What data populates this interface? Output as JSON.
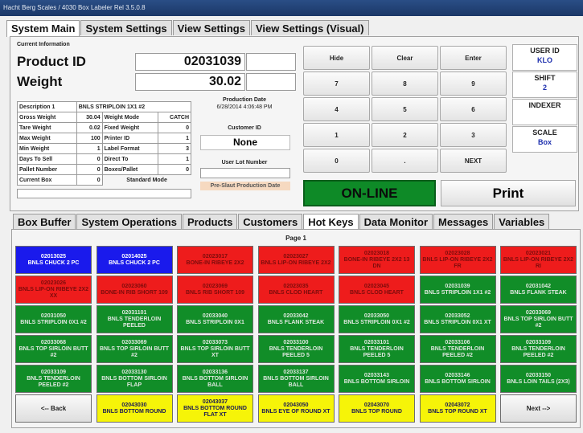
{
  "window": {
    "title": "Hacht Berg Scales / 4030 Box Labeler Rel 3.5.0.8"
  },
  "top_tabs": [
    "System Main",
    "System Settings",
    "View Settings",
    "View Settings (Visual)"
  ],
  "current_info": {
    "section_label": "Current Information",
    "product_id_label": "Product ID",
    "product_id_value": "02031039",
    "weight_label": "Weight",
    "weight_value": "30.02"
  },
  "details": {
    "description_label": "Description 1",
    "description_value": "BNLS STRIPLOIN 1X1 #2",
    "left": [
      {
        "label": "Gross Weight",
        "value": "30.04"
      },
      {
        "label": "Tare Weight",
        "value": "0.02"
      },
      {
        "label": "Max Weight",
        "value": "100"
      },
      {
        "label": "Min Weight",
        "value": "1"
      },
      {
        "label": "Days To Sell",
        "value": "0"
      },
      {
        "label": "Pallet Number",
        "value": "0"
      },
      {
        "label": "Current Box",
        "value": "0"
      }
    ],
    "right": [
      {
        "label": "Weight Mode",
        "value": "CATCH"
      },
      {
        "label": "Fixed Weight",
        "value": "0"
      },
      {
        "label": "Printer ID",
        "value": "1"
      },
      {
        "label": "Label Format",
        "value": "3"
      },
      {
        "label": "Direct To",
        "value": "1"
      },
      {
        "label": "Boxes/Pallet",
        "value": "0"
      }
    ],
    "standard_mode": "Standard Mode"
  },
  "production": {
    "date_label": "Production Date",
    "date_value": "6/28/2014 4:06:48 PM",
    "customer_id_label": "Customer ID",
    "customer_id_value": "None",
    "lot_label": "User Lot Number",
    "pre_slaut_label": "Pre-Slaut Production Date"
  },
  "keypad": [
    "Hide",
    "Clear",
    "Enter",
    "7",
    "8",
    "9",
    "4",
    "5",
    "6",
    "1",
    "2",
    "3",
    "0",
    ".",
    "NEXT"
  ],
  "right_panel": {
    "user_id_label": "USER ID",
    "user_id_value": "KLO",
    "shift_label": "SHIFT",
    "shift_value": "2",
    "indexer_label": "INDEXER",
    "scale_label": "SCALE",
    "scale_value": "Box"
  },
  "status": {
    "online": "ON-LINE",
    "print": "Print"
  },
  "bottom_tabs": [
    "Box Buffer",
    "System Operations",
    "Products",
    "Customers",
    "Hot Keys",
    "Data Monitor",
    "Messages",
    "Variables"
  ],
  "hotkeys": {
    "page_label": "Page 1",
    "rows": [
      [
        {
          "code": "02013025",
          "name": "BNLS CHUCK 2 PC",
          "color": "blue"
        },
        {
          "code": "02014025",
          "name": "BNLS CHUCK 2 PC",
          "color": "blue"
        },
        {
          "code": "02023017",
          "name": "BONE-IN RIBEYE 2X2",
          "color": "red"
        },
        {
          "code": "02023027",
          "name": "BNLS LIP-ON RIBEYE 2X2",
          "color": "red"
        },
        {
          "code": "02023018",
          "name": "BONE-IN RIBEYE 2X2 13 DN",
          "color": "red"
        },
        {
          "code": "02023028",
          "name": "BNLS LIP-ON RIBEYE 2X2 FR",
          "color": "red"
        },
        {
          "code": "02023021",
          "name": "BNLS LIP-ON RIBEYE 2X2 RI",
          "color": "red"
        }
      ],
      [
        {
          "code": "02023026",
          "name": "BNLS LIP-ON RIBEYE 2X2 XX",
          "color": "red"
        },
        {
          "code": "02023060",
          "name": "BONE-IN RIB SHORT 109",
          "color": "red"
        },
        {
          "code": "02023069",
          "name": "BNLS RIB SHORT 109",
          "color": "red"
        },
        {
          "code": "02023035",
          "name": "BNLS CLOD HEART",
          "color": "red"
        },
        {
          "code": "02023045",
          "name": "BNLS CLOD HEART",
          "color": "red"
        },
        {
          "code": "02031039",
          "name": "BNLS STRIPLOIN 1X1 #2",
          "color": "green"
        },
        {
          "code": "02031042",
          "name": "BNLS FLANK STEAK",
          "color": "green"
        }
      ],
      [
        {
          "code": "02031050",
          "name": "BNLS STRIPLOIN 0X1 #2",
          "color": "green"
        },
        {
          "code": "02031101",
          "name": "BNLS TENDERLOIN PEELED",
          "color": "green"
        },
        {
          "code": "02033040",
          "name": "BNLS STRIPLOIN 0X1",
          "color": "green"
        },
        {
          "code": "02033042",
          "name": "BNLS FLANK STEAK",
          "color": "green"
        },
        {
          "code": "02033050",
          "name": "BNLS STRIPLOIN 0X1 #2",
          "color": "green"
        },
        {
          "code": "02033052",
          "name": "BNLS STRIPLOIN 0X1 XT",
          "color": "green"
        },
        {
          "code": "02033069",
          "name": "BNLS TOP SIRLOIN BUTT #2",
          "color": "green"
        }
      ],
      [
        {
          "code": "02033068",
          "name": "BNLS TOP SIRLOIN BUTT #2",
          "color": "green"
        },
        {
          "code": "02033069",
          "name": "BNLS TOP SIRLOIN BUTT #2",
          "color": "green"
        },
        {
          "code": "02033073",
          "name": "BNLS TOP SIRLOIN BUTT XT",
          "color": "green"
        },
        {
          "code": "02033100",
          "name": "BNLS TENDERLOIN PEELED 5",
          "color": "green"
        },
        {
          "code": "02033101",
          "name": "BNLS TENDERLOIN PEELED 5",
          "color": "green"
        },
        {
          "code": "02033106",
          "name": "BNLS TENDERLOIN PEELED #2",
          "color": "green"
        },
        {
          "code": "02033109",
          "name": "BNLS TENDERLOIN PEELED #2",
          "color": "green"
        }
      ],
      [
        {
          "code": "02033109",
          "name": "BNLS TENDERLOIN PEELED #2",
          "color": "green"
        },
        {
          "code": "02033130",
          "name": "BNLS BOTTOM SIRLOIN FLAP",
          "color": "green"
        },
        {
          "code": "02033136",
          "name": "BNLS BOTTOM SIRLOIN BALL",
          "color": "green"
        },
        {
          "code": "02033137",
          "name": "BNLS BOTTOM SIRLOIN BALL",
          "color": "green"
        },
        {
          "code": "02033143",
          "name": "BNLS BOTTOM SIRLOIN",
          "color": "green"
        },
        {
          "code": "02033146",
          "name": "BNLS BOTTOM SIRLOIN",
          "color": "green"
        },
        {
          "code": "02033150",
          "name": "BNLS LOIN TAILS (2X3)",
          "color": "green"
        }
      ],
      [
        {
          "code": "",
          "name": "<-- Back",
          "color": "gray"
        },
        {
          "code": "02043030",
          "name": "BNLS BOTTOM ROUND",
          "color": "yellow"
        },
        {
          "code": "02043037",
          "name": "BNLS BOTTOM ROUND FLAT XT",
          "color": "yellow"
        },
        {
          "code": "02043050",
          "name": "BNLS EYE OF ROUND XT",
          "color": "yellow"
        },
        {
          "code": "02043070",
          "name": "BNLS TOP ROUND",
          "color": "yellow"
        },
        {
          "code": "02043072",
          "name": "BNLS TOP ROUND XT",
          "color": "yellow"
        },
        {
          "code": "",
          "name": "Next -->",
          "color": "gray"
        }
      ]
    ]
  }
}
